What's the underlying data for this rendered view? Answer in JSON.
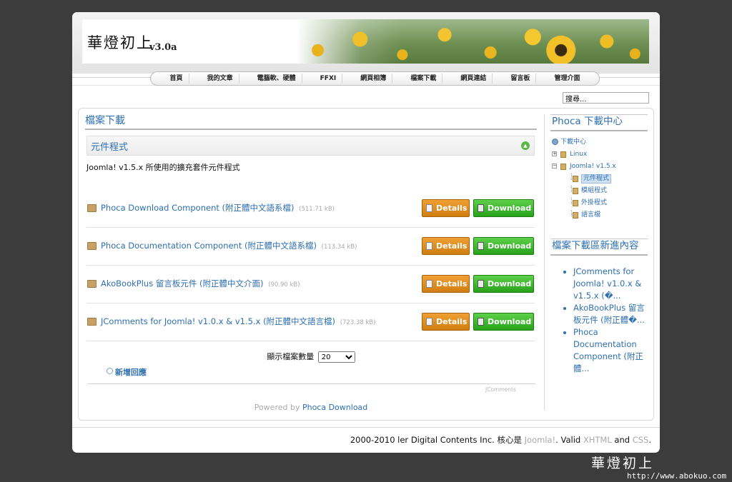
{
  "header": {
    "site_title": "華燈初上",
    "site_version": "v3.0a"
  },
  "nav": {
    "items": [
      "首頁",
      "我的文章",
      "電腦軟、硬體",
      "FFXI",
      "網頁相簿",
      "檔案下載",
      "網頁連結",
      "留言板",
      "管理介面"
    ]
  },
  "search": {
    "value": "搜尋..."
  },
  "main": {
    "title": "檔案下載",
    "section_title": "元件程式",
    "section_description": "Joomla! v1.5.x 所使用的擴充套件元件程式",
    "files": [
      {
        "name": "Phoca Download Component (附正體中文語系檔)",
        "size": "(511.71 kB)",
        "details": "Details",
        "download": "Download"
      },
      {
        "name": "Phoca Documentation Component (附正體中文語系檔)",
        "size": "(113.34 kB)",
        "details": "Details",
        "download": "Download"
      },
      {
        "name": "AkoBookPlus 留言板元件 (附正體中文介面)",
        "size": "(90.90 kB)",
        "details": "Details",
        "download": "Download"
      },
      {
        "name": "JComments for Joomla! v1.0.x & v1.5.x (附正體中文語言檔)",
        "size": "(723.38 kB)",
        "details": "Details",
        "download": "Download"
      }
    ],
    "pager_label": "顯示檔案數量",
    "pager_value": "20",
    "add_comment": "新增回應",
    "jcomments_label": "JComments",
    "powered_prefix": "Powered by",
    "powered_link": "Phoca Download"
  },
  "sidebar": {
    "title": "Phoca 下載中心",
    "tree": {
      "root": "下載中心",
      "linux": "Linux",
      "joomla": "Joomla! v1.5.x",
      "children": [
        "元件程式",
        "模組程式",
        "外掛程式",
        "語言檔"
      ]
    },
    "recent_title": "檔案下載區新進內容",
    "recent_items": [
      "JComments for Joomla! v1.0.x & v1.5.x (�...",
      "AkoBookPlus 留言板元件 (附正體�...",
      "Phoca Documentation Component (附正體..."
    ]
  },
  "footer": {
    "copyright": "2000-2010 ler Digital Contents Inc. 核心是",
    "joomla": "Joomla!",
    "valid": ". Valid",
    "xhtml": "XHTML",
    "and": "and",
    "css": "CSS",
    "end": "."
  },
  "watermark": {
    "logo": "華燈初上",
    "url": "http://www.abokuo.com"
  }
}
